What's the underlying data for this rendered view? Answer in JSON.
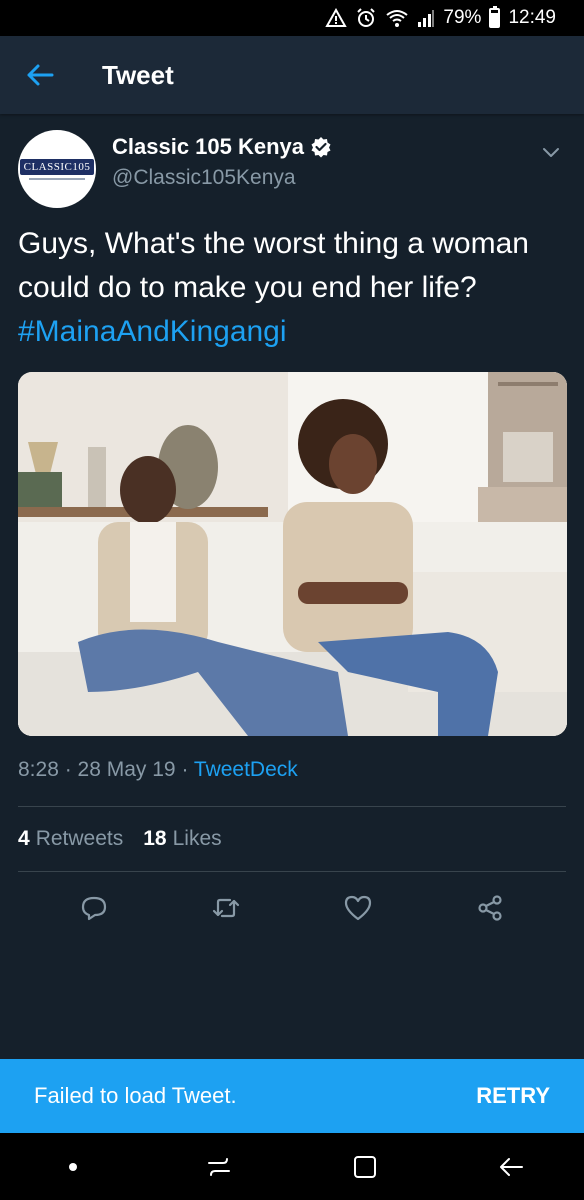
{
  "status_bar": {
    "battery": "79%",
    "battery_level": 0.79,
    "time": "12:49",
    "icons": [
      "warning-icon",
      "alarm-icon",
      "wifi-icon",
      "signal-icon",
      "battery-icon"
    ]
  },
  "header": {
    "title": "Tweet",
    "back_icon": "arrow-left-icon"
  },
  "tweet": {
    "author": {
      "name": "Classic 105 Kenya",
      "handle": "@Classic105Kenya",
      "verified": true,
      "avatar_logo_text": "CLASSIC105"
    },
    "text": "Guys, What's the worst thing a woman could do to make you end her life? ",
    "hashtag": "#MainaAndKingangi",
    "time": "8:28",
    "separator": " · ",
    "date": "28 May 19",
    "source": "TweetDeck",
    "stats": {
      "retweets_count": "4",
      "retweets_label": "Retweets",
      "likes_count": "18",
      "likes_label": "Likes"
    },
    "actions": [
      "reply-icon",
      "retweet-icon",
      "like-icon",
      "share-icon"
    ]
  },
  "snackbar": {
    "message": "Failed to load Tweet.",
    "action": "RETRY"
  },
  "nav_bar": {
    "buttons": [
      "dot-icon",
      "recent-apps-icon",
      "home-icon",
      "back-icon"
    ]
  },
  "colors": {
    "background": "#15202b",
    "header": "#1c2938",
    "accent": "#1da1f2",
    "secondary_text": "#8899a6",
    "divider": "#38444d"
  }
}
